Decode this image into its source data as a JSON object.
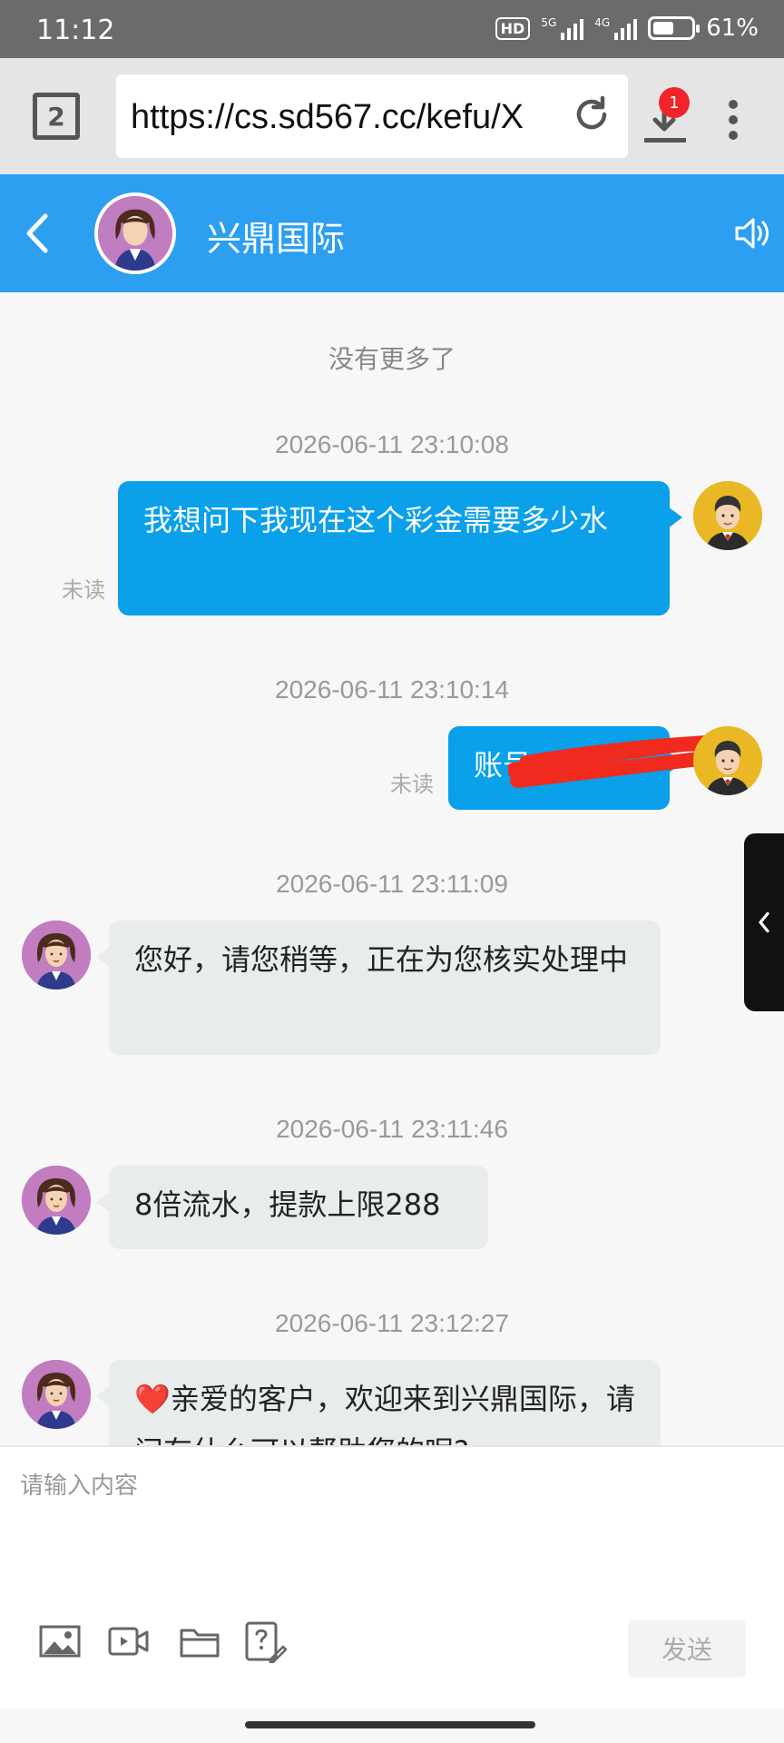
{
  "statusbar": {
    "time": "11:12",
    "hd": "HD",
    "net1": "5G",
    "net2": "4G",
    "battery_percent": 61,
    "battery_label": "61%"
  },
  "browser": {
    "tab_count": "2",
    "url": "https://cs.sd567.cc/kefu/X",
    "download_badge": "1"
  },
  "chat_header": {
    "title": "兴鼎国际"
  },
  "chat": {
    "no_more": "没有更多了",
    "unread_label": "未读",
    "messages": [
      {
        "time": "2026-06-11 23:10:08",
        "from": "user",
        "text": "我想问下我现在这个彩金需要多少水"
      },
      {
        "time": "2026-06-11 23:10:14",
        "from": "user",
        "text": "账号"
      },
      {
        "time": "2026-06-11 23:11:09",
        "from": "agent",
        "text": "您好，请您稍等，正在为您核实处理中"
      },
      {
        "time": "2026-06-11 23:11:46",
        "from": "agent",
        "text": "8倍流水，提款上限288"
      },
      {
        "time": "2026-06-11 23:12:27",
        "from": "agent",
        "text": "❤️亲爱的客户，欢迎来到兴鼎国际，请问有什么可以帮助您的呢?"
      }
    ]
  },
  "input": {
    "placeholder": "请输入内容",
    "send_label": "发送"
  },
  "colors": {
    "header_blue": "#2d9ff0",
    "user_bubble": "#0aa0ea",
    "agent_bubble": "#e8eced",
    "redaction": "#f02a1e"
  }
}
